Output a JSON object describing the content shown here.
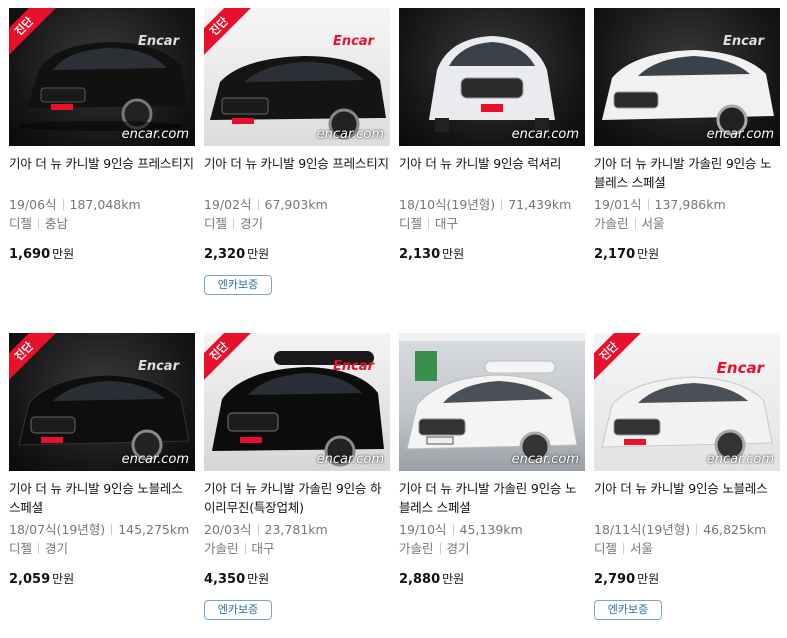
{
  "listings": [
    {
      "title": "기아 더 뉴 카니발 9인승 프레스티지",
      "year": "19/06식",
      "km": "187,048km",
      "fuel": "디젤",
      "region": "충남",
      "price": "1,690",
      "unit": "만원",
      "badge": "진단",
      "brand": "Encar",
      "watermark": "encar.com",
      "warranty": "",
      "car_color": "#111111"
    },
    {
      "title": "기아 더 뉴 카니발 9인승 프레스티지",
      "year": "19/02식",
      "km": "67,903km",
      "fuel": "디젤",
      "region": "경기",
      "price": "2,320",
      "unit": "만원",
      "badge": "진단",
      "brand": "Encar",
      "watermark": "encar.com",
      "warranty": "엔카보증",
      "car_color": "#141414"
    },
    {
      "title": "기아 더 뉴 카니발 9인승 럭셔리",
      "year": "18/10식(19년형)",
      "km": "71,439km",
      "fuel": "디젤",
      "region": "대구",
      "price": "2,130",
      "unit": "만원",
      "badge": "",
      "brand": "",
      "watermark": "encar.com",
      "warranty": "",
      "car_color": "#e9ebee"
    },
    {
      "title": "기아 더 뉴 카니발 가솔린 9인승 노블레스 스페셜",
      "year": "19/01식",
      "km": "137,986km",
      "fuel": "가솔린",
      "region": "서울",
      "price": "2,170",
      "unit": "만원",
      "badge": "",
      "brand": "Encar",
      "watermark": "encar.com",
      "warranty": "",
      "car_color": "#f1f1f1"
    },
    {
      "title": "기아 더 뉴 카니발 9인승 노블레스 스페셜",
      "year": "18/07식(19년형)",
      "km": "145,275km",
      "fuel": "디젤",
      "region": "경기",
      "price": "2,059",
      "unit": "만원",
      "badge": "진단",
      "brand": "Encar",
      "watermark": "encar.com",
      "warranty": "",
      "car_color": "#0e0e0e"
    },
    {
      "title": "기아 더 뉴 카니발 가솔린 9인승 하이리무진(특장업체)",
      "year": "20/03식",
      "km": "23,781km",
      "fuel": "가솔린",
      "region": "대구",
      "price": "4,350",
      "unit": "만원",
      "badge": "진단",
      "brand": "Encar",
      "watermark": "encar.com",
      "warranty": "엔카보증",
      "car_color": "#0c0c0c"
    },
    {
      "title": "기아 더 뉴 카니발 가솔린 9인승 노블레스 스페셜",
      "year": "19/10식",
      "km": "45,139km",
      "fuel": "가솔린",
      "region": "경기",
      "price": "2,880",
      "unit": "만원",
      "badge": "",
      "brand": "",
      "watermark": "encar.com",
      "warranty": "",
      "car_color": "#f4f4f4"
    },
    {
      "title": "기아 더 뉴 카니발 9인승 노블레스",
      "year": "18/11식(19년형)",
      "km": "46,825km",
      "fuel": "디젤",
      "region": "서울",
      "price": "2,790",
      "unit": "만원",
      "badge": "진단",
      "brand": "Encar",
      "watermark": "encar.com",
      "warranty": "엔카보증",
      "car_color": "#f2f2f2"
    }
  ]
}
